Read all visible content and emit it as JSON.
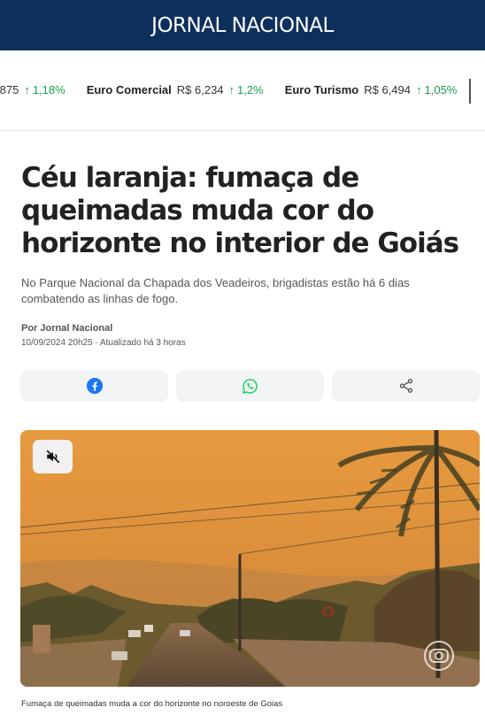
{
  "header": {
    "brand": "JORNAL NACIONAL"
  },
  "ticker": [
    {
      "name": "",
      "price": ",875",
      "change": "1,18%"
    },
    {
      "name": "Euro Comercial",
      "price": "R$ 6,234",
      "change": "1,2%"
    },
    {
      "name": "Euro Turismo",
      "price": "R$ 6,494",
      "change": "1,05%"
    }
  ],
  "article": {
    "title": "Céu laranja: fumaça de queimadas muda cor do horizonte no interior de Goiás",
    "subtitle": "No Parque Nacional da Chapada dos Veadeiros, brigadistas estão há 6 dias combatendo as linhas de fogo.",
    "byline": "Por Jornal Nacional",
    "dateline": "10/09/2024 20h25 · Atualizado há 3 horas",
    "caption": "Fumaça de queimadas muda a cor do horizonte no noroeste de Goias"
  },
  "share": [
    {
      "icon": "facebook-icon",
      "color": "#1877f2"
    },
    {
      "icon": "whatsapp-icon",
      "color": "#25d366"
    },
    {
      "icon": "share-icon",
      "color": "#555555"
    }
  ],
  "colors": {
    "header_bg": "#0d2f5c",
    "positive": "#1a9d4a",
    "sky": "#e89a3c"
  }
}
